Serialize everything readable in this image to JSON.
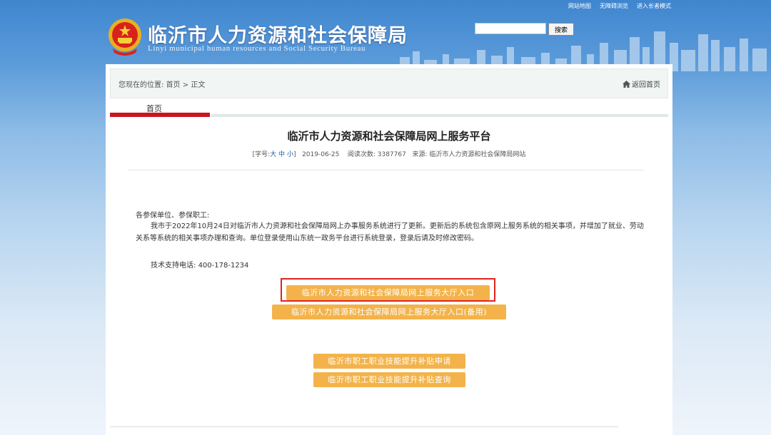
{
  "header": {
    "top_links": [
      "网站地图",
      "无障碍浏览",
      "进入长者模式"
    ],
    "title": "临沂市人力资源和社会保障局",
    "subtitle": "Linyi municipal human resources and Social Security Bureau",
    "search": {
      "placeholder": "",
      "button_label": "搜索"
    }
  },
  "breadcrumb": {
    "prefix": "您现在的位置:",
    "home": "首页",
    "separator": ">",
    "current": "正文",
    "back_label": "返回首页"
  },
  "tabs": {
    "active_label": "首页"
  },
  "article": {
    "title": "临沂市人力资源和社会保障局网上服务平台",
    "meta": {
      "font_label_open": "[字号:",
      "font_sizes": [
        "大",
        "中",
        "小"
      ],
      "font_label_close": "]",
      "date": "2019-06-25",
      "views_label": "阅读次数:",
      "views": "3387767",
      "source_label": "来源:",
      "source": "临沂市人力资源和社会保障局网站"
    },
    "greeting": "各参保单位、参保职工:",
    "paragraph": "我市于2022年10月24日对临沂市人力资源和社会保障局网上办事服务系统进行了更新。更新后的系统包含原网上服务系统的相关事项，并增加了就业、劳动关系等系统的相关事项办理和查询。单位登录使用山东统一政务平台进行系统登录，登录后请及时修改密码。",
    "phone_label": "技术支持电话:",
    "phone": "400-178-1234"
  },
  "buttons": {
    "main_entry": "临沂市人力资源和社会保障局网上服务大厅入口",
    "backup_entry": "临沂市人力资源和社会保障局网上服务大厅入口(备用)",
    "subsidy_apply": "临沂市职工职业技能提升补贴申请",
    "subsidy_query": "临沂市职工职业技能提升补贴查询"
  },
  "colors": {
    "header_blue": "#3f86cf",
    "button_orange": "#f3b34a",
    "active_tab_red": "#c9151e",
    "highlight_red": "#e0231d"
  }
}
